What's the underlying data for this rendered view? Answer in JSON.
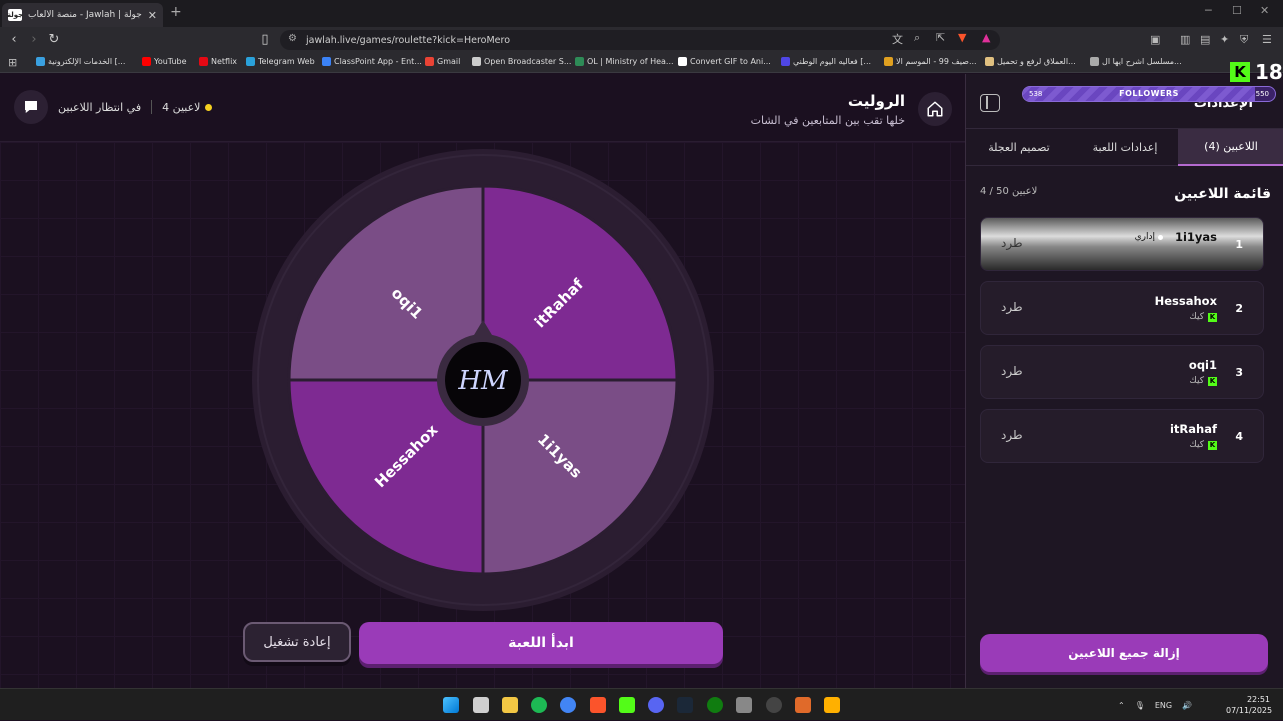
{
  "browser": {
    "tab_title": "جولة | Jawlah - منصة الألعاب التفا...",
    "tab_favicon_text": "جولة",
    "url": "jawlah.live/games/roulette?kick=HeroMero",
    "bookmarks": [
      {
        "label": "الخدمات الإلكترونية [...",
        "color": "#3aa0e0"
      },
      {
        "label": "YouTube",
        "color": "#ff0000"
      },
      {
        "label": "Netflix",
        "color": "#e50914"
      },
      {
        "label": "Telegram Web",
        "color": "#2aa1da"
      },
      {
        "label": "ClassPoint App - Ent...",
        "color": "#3b82f6"
      },
      {
        "label": "Gmail",
        "color": "#ea4335"
      },
      {
        "label": "Open Broadcaster S...",
        "color": "#cccccc"
      },
      {
        "label": "OL | Ministry of Hea...",
        "color": "#2e8b57"
      },
      {
        "label": "Convert GIF to Ani...",
        "color": "#ffffff"
      },
      {
        "label": "فعاليه اليوم الوطني [...",
        "color": "#4f46e5"
      },
      {
        "label": "صيف 99 - الموسم الا...",
        "color": "#e0a020"
      },
      {
        "label": "العملاق لرفع و تحميل...",
        "color": "#e0c080"
      },
      {
        "label": "مسلسل اشرح ايها ال...",
        "color": "#aaaaaa"
      }
    ]
  },
  "header": {
    "title": "الروليت",
    "subtitle": "خلها تقب بين المتابعين في الشات",
    "status": "في انتظار اللاعبين",
    "player_count": "4 لاعبين"
  },
  "wheel": {
    "center_logo": "HM",
    "segments": [
      {
        "name": "oqi1",
        "color": "#7a4d86"
      },
      {
        "name": "itRahaf",
        "color": "#7e2a92"
      },
      {
        "name": "1i1yas",
        "color": "#7a4d86"
      },
      {
        "name": "Hessahox",
        "color": "#7e2a92"
      }
    ]
  },
  "controls": {
    "restart": "إعادة تشغيل",
    "start": "ابدأ اللعبة"
  },
  "panel": {
    "title": "الإعدادات",
    "tabs": [
      "اللاعبين (4)",
      "إعدادات اللعبة",
      "تصميم العجلة"
    ],
    "list_title": "قائمة اللاعبين",
    "list_count": "4 / 50 لاعبين",
    "players": [
      {
        "num": "1",
        "name": "1i1yas",
        "role": "إداري",
        "type": "",
        "kick": "طرد"
      },
      {
        "num": "2",
        "name": "Hessahox",
        "type": "كيك",
        "kick": "طرد"
      },
      {
        "num": "3",
        "name": "oqi1",
        "type": "كيك",
        "kick": "طرد"
      },
      {
        "num": "4",
        "name": "itRahaf",
        "type": "كيك",
        "kick": "طرد"
      }
    ],
    "remove_all": "إزالة جميع اللاعبين"
  },
  "overlay": {
    "followers_label": "FOLLOWERS",
    "followers_min": "538",
    "followers_max": "550",
    "followers_progress": 0.92,
    "kick_viewers": "18"
  },
  "taskbar": {
    "lang": "ENG",
    "time": "22:51",
    "date": "07/11/2025"
  }
}
